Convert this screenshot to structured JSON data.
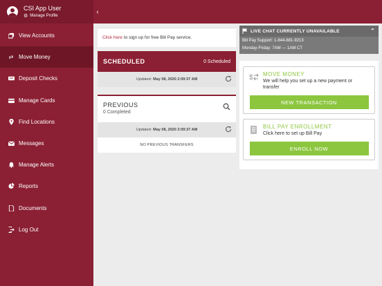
{
  "sidebar": {
    "user_name": "CSI App User",
    "manage_profile": "Manage Profile",
    "items": [
      {
        "label": "View Accounts",
        "icon": "accounts-icon"
      },
      {
        "label": "Move Money",
        "icon": "transfer-icon",
        "active": true
      },
      {
        "label": "Deposit Checks",
        "icon": "check-icon"
      },
      {
        "label": "Manage Cards",
        "icon": "card-icon"
      },
      {
        "label": "Find Locations",
        "icon": "location-pin-icon"
      },
      {
        "label": "Messages",
        "icon": "envelope-icon"
      },
      {
        "label": "Manage Alerts",
        "icon": "bell-icon"
      },
      {
        "label": "Reports",
        "icon": "pie-chart-icon"
      },
      {
        "label": "Documents",
        "icon": "document-icon"
      },
      {
        "label": "Log Out",
        "icon": "logout-icon"
      }
    ]
  },
  "banner": {
    "link_text": "Click here",
    "text": "to sign up for free Bill Pay service."
  },
  "scheduled": {
    "title": "SCHEDULED",
    "count": "0 Scheduled",
    "updated_label": "Updated:",
    "updated_value": "May 08, 2020 2:09:37 AM"
  },
  "previous": {
    "title": "PREVIOUS",
    "count": "0 Completed",
    "updated_label": "Updated:",
    "updated_value": "May 08, 2020 2:09:37 AM",
    "empty": "NO PREVIOUS TRANSFERS"
  },
  "chat": {
    "title": "LIVE CHAT CURRENTLY UNAVAILABLE",
    "support": "Bill Pay Support: 1-844-881-9213",
    "hours": "Monday-Friday: 7AM — 1AM CT"
  },
  "move_money": {
    "title": "MOVE MONEY",
    "desc": "We will help you set up a new payment or transfer",
    "button": "NEW TRANSACTION"
  },
  "bill_pay": {
    "title": "BILL PAY ENROLLMENT",
    "desc": "Click here to set up Bill Pay",
    "button": "ENROLL NOW"
  },
  "colors": {
    "brand": "#8b1f33",
    "accent_green": "#8cc63f",
    "link_red": "#b22a3c"
  }
}
